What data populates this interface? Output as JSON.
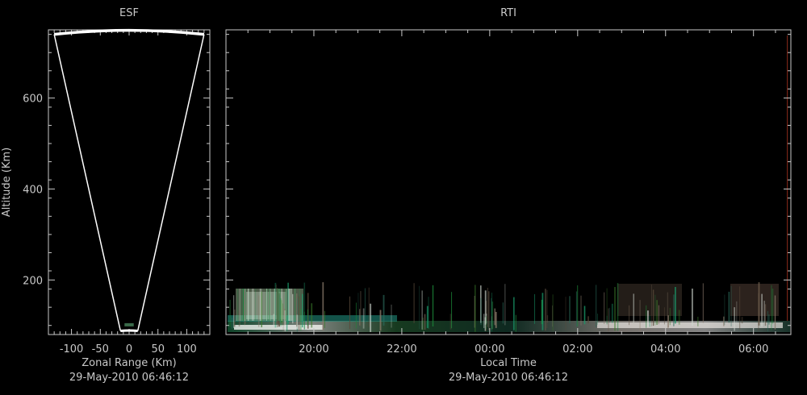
{
  "colors": {
    "background": "#000000",
    "axis": "#c8c8c8",
    "wedge": "#ffffff",
    "marker": "#8b2a1a"
  },
  "chart_data": [
    {
      "type": "scatter",
      "title": "ESF",
      "xlabel": "Zonal Range (Km)",
      "ylabel": "Altitude (Km)",
      "timestamp": "29-May-2010 06:46:12",
      "xlim": [
        -140,
        140
      ],
      "ylim": [
        80,
        750
      ],
      "x_ticks": [
        -100,
        -50,
        0,
        50,
        100
      ],
      "x_tick_labels": [
        "-100",
        "-50",
        "0",
        "50",
        "100"
      ],
      "y_ticks": [
        200,
        400,
        600
      ],
      "y_tick_labels": [
        "200",
        "400",
        "600"
      ],
      "wedge": {
        "left_top": -130,
        "right_top": 130,
        "top": 740,
        "left_bottom": -15,
        "right_bottom": 15,
        "bottom": 88
      }
    },
    {
      "type": "heatmap",
      "title": "RTI",
      "xlabel": "Local Time",
      "timestamp": "29-May-2010 06:46:12",
      "x_tick_labels": [
        "20:00",
        "22:00",
        "00:00",
        "02:00",
        "04:00",
        "06:00"
      ],
      "x_ticks_hours": [
        20,
        22,
        24,
        26,
        28,
        30
      ],
      "xlim_hours": [
        18.0,
        30.85
      ],
      "ylim": [
        80,
        750
      ],
      "y_ticks": [
        200,
        400,
        600
      ],
      "current_time_hours": 30.77
    }
  ]
}
